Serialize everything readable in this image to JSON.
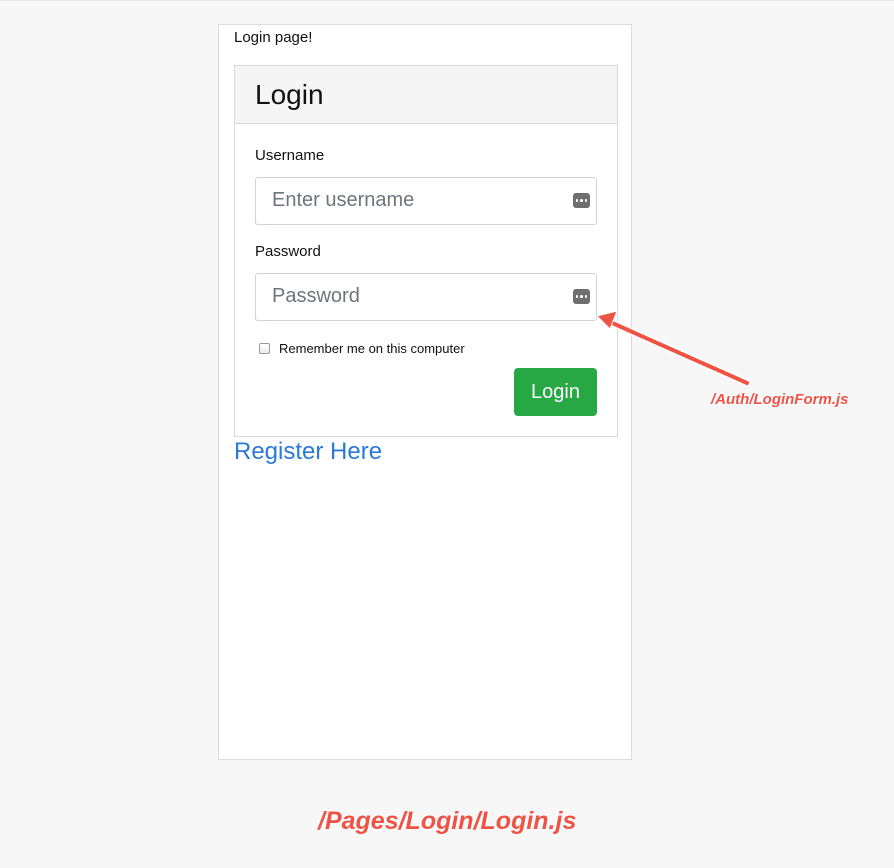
{
  "page": {
    "heading": "Login page!"
  },
  "login_card": {
    "title": "Login",
    "username_label": "Username",
    "username_placeholder": "Enter username",
    "username_value": "",
    "password_label": "Password",
    "password_placeholder": "Password",
    "password_value": "",
    "remember_label": "Remember me on this computer",
    "remember_checked": false,
    "submit_label": "Login",
    "icons": {
      "username_field_icon": "password-manager-key-icon",
      "password_field_icon": "password-manager-key-icon"
    }
  },
  "register": {
    "link_text": "Register Here"
  },
  "annotations": {
    "component_label": "/Auth/LoginForm.js",
    "page_label": "/Pages/Login/Login.js",
    "color": "#ee5346"
  },
  "colors": {
    "accent_button": "#28a745",
    "link": "#2a7ad8",
    "page_background": "#f7f7f7"
  }
}
